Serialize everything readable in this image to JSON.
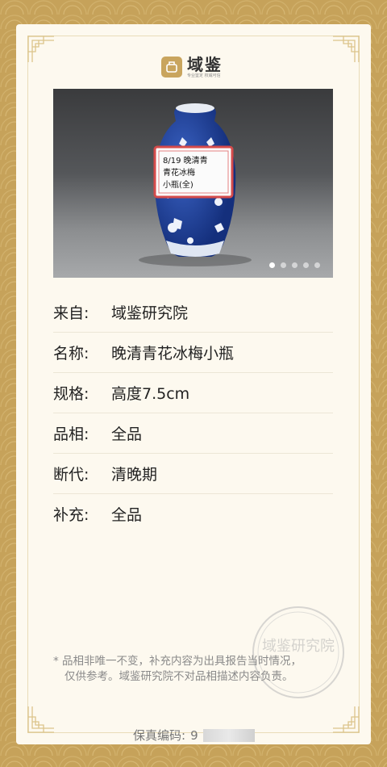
{
  "brand": {
    "title": "域鉴",
    "subtitle": "专业鉴定 权威可信"
  },
  "gallery": {
    "label_lines": [
      "8/19 晚清青",
      "青花冰梅",
      "小瓶(全)"
    ],
    "dot_count": 5,
    "active_index": 0
  },
  "details": [
    {
      "label": "来自:",
      "value": "域鉴研究院"
    },
    {
      "label": "名称:",
      "value": "晚清青花冰梅小瓶"
    },
    {
      "label": "规格:",
      "value": "高度7.5cm"
    },
    {
      "label": "品相:",
      "value": "全品"
    },
    {
      "label": "断代:",
      "value": "清晚期"
    },
    {
      "label": "补充:",
      "value": "全品"
    }
  ],
  "note": {
    "line1": "* 品相非唯一不变，补充内容为出具报告当时情况，",
    "line2": "仅供参考。域鉴研究院不对品相描述内容负责。"
  },
  "serial": {
    "label": "保真编码:",
    "value_visible": "9"
  },
  "seal": {
    "text": "域鉴研究院"
  },
  "colors": {
    "gold": "#c9a55e",
    "card": "#fdf9ef",
    "porcelain_blue": "#1f3f9a"
  }
}
